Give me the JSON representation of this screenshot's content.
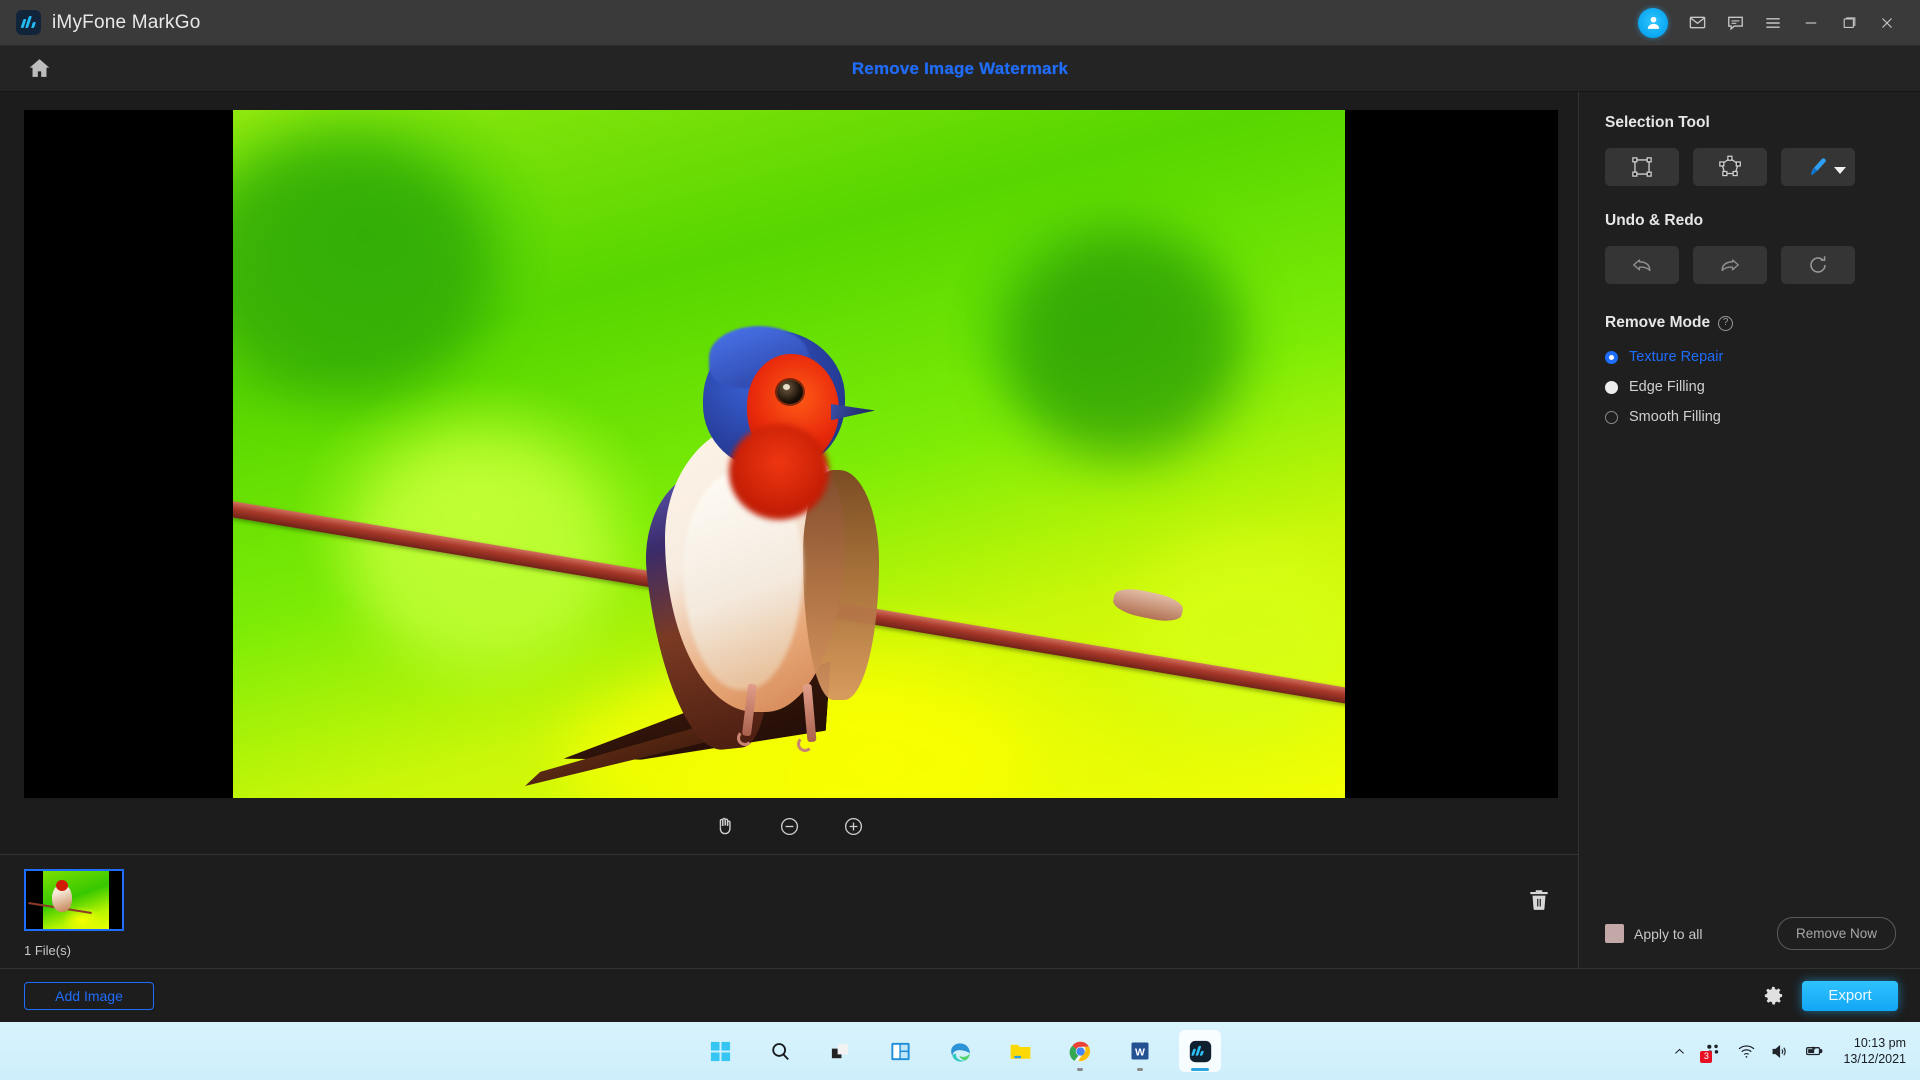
{
  "titlebar": {
    "app_name": "iMyFone MarkGo",
    "logo_icon": "markgo-logo",
    "actions": [
      {
        "name": "account-avatar",
        "icon": "user-avatar-icon",
        "label": ""
      },
      {
        "name": "mail-button",
        "icon": "mail-icon",
        "label": ""
      },
      {
        "name": "feedback-button",
        "icon": "chat-bubble-icon",
        "label": ""
      },
      {
        "name": "menu-button",
        "icon": "hamburger-menu-icon",
        "label": ""
      },
      {
        "name": "minimize-button",
        "icon": "minimize-icon",
        "label": ""
      },
      {
        "name": "maximize-button",
        "icon": "restore-window-icon",
        "label": ""
      },
      {
        "name": "close-button",
        "icon": "close-icon",
        "label": ""
      }
    ]
  },
  "header": {
    "home_icon": "home-icon",
    "title": "Remove Image Watermark",
    "title_color": "#1f6dfb"
  },
  "canvas": {
    "zoom_controls": [
      {
        "name": "pan-tool",
        "icon": "hand-icon"
      },
      {
        "name": "zoom-out",
        "icon": "minus-circle-icon"
      },
      {
        "name": "zoom-in",
        "icon": "plus-circle-icon"
      }
    ],
    "image_alt": "Barn swallow perched on a branch against a vivid green and yellow background"
  },
  "file_strip": {
    "thumbnail_name": "image-thumbnail",
    "selected": true,
    "file_count": "1 File(s)",
    "delete_icon": "trash-icon"
  },
  "sidebar": {
    "selection_tool": {
      "title": "Selection Tool",
      "tools": [
        {
          "name": "rectangle-select-tool",
          "icon": "rectangle-marquee-icon",
          "active": false
        },
        {
          "name": "polygon-select-tool",
          "icon": "polygon-lasso-icon",
          "active": false
        },
        {
          "name": "brush-select-tool",
          "icon": "brush-icon",
          "active": true,
          "has_dropdown": true
        }
      ]
    },
    "undo_redo": {
      "title": "Undo & Redo",
      "buttons": [
        {
          "name": "undo-button",
          "icon": "undo-arrow-icon"
        },
        {
          "name": "redo-button",
          "icon": "redo-arrow-icon"
        },
        {
          "name": "reset-button",
          "icon": "refresh-icon"
        }
      ]
    },
    "remove_mode": {
      "title": "Remove Mode",
      "help_icon": "question-mark-icon",
      "options": [
        {
          "label": "Texture Repair",
          "state": "selected"
        },
        {
          "label": "Edge Filling",
          "state": "filled"
        },
        {
          "label": "Smooth Filling",
          "state": "empty"
        }
      ]
    },
    "footer": {
      "apply_to_all_label": "Apply to all",
      "apply_to_all_checked": false,
      "remove_now_label": "Remove Now"
    }
  },
  "actionbar": {
    "add_image_label": "Add Image",
    "settings_icon": "gear-icon",
    "export_label": "Export"
  },
  "taskbar": {
    "apps": [
      {
        "name": "start-button",
        "icon": "windows-start-icon"
      },
      {
        "name": "search-button",
        "icon": "search-icon"
      },
      {
        "name": "task-view-button",
        "icon": "task-view-icon"
      },
      {
        "name": "widgets-button",
        "icon": "widgets-icon"
      },
      {
        "name": "microsoft-edge",
        "icon": "edge-icon"
      },
      {
        "name": "file-explorer",
        "icon": "folder-icon"
      },
      {
        "name": "google-chrome",
        "icon": "chrome-icon"
      },
      {
        "name": "microsoft-word",
        "icon": "word-icon"
      },
      {
        "name": "imyfone-markgo",
        "icon": "markgo-icon"
      }
    ],
    "tray": {
      "chevron_icon": "chevron-up-icon",
      "notification_count": "3",
      "wifi_icon": "wifi-icon",
      "volume_icon": "speaker-icon",
      "battery_icon": "battery-charging-icon",
      "time": "10:13 pm",
      "date": "13/12/2021"
    }
  }
}
